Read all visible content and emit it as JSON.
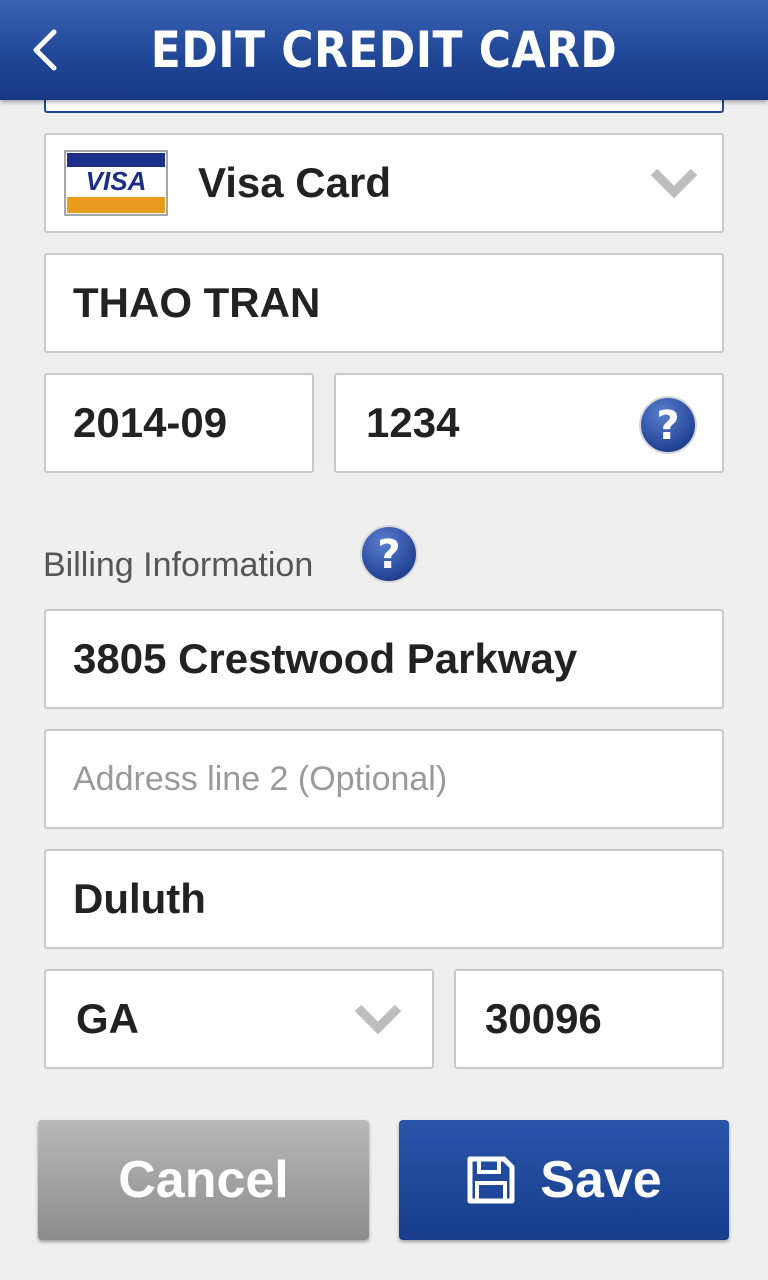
{
  "header": {
    "title": "EDIT CREDIT CARD",
    "back_icon": "chevron-left-icon"
  },
  "card": {
    "type_label": "Visa Card",
    "logo_text": "VISA",
    "name": "THAO TRAN",
    "expiry": "2014-09",
    "cvv": "1234"
  },
  "billing": {
    "label": "Billing Information",
    "address1": "3805 Crestwood Parkway",
    "address2_placeholder": "Address line 2 (Optional)",
    "city": "Duluth",
    "state": "GA",
    "zip": "30096"
  },
  "actions": {
    "cancel_label": "Cancel",
    "save_label": "Save"
  },
  "colors": {
    "header": "#1f4595",
    "save_button": "#1f4595",
    "cancel_button": "#9e9e9e",
    "help_icon": "#2a4ea3"
  }
}
